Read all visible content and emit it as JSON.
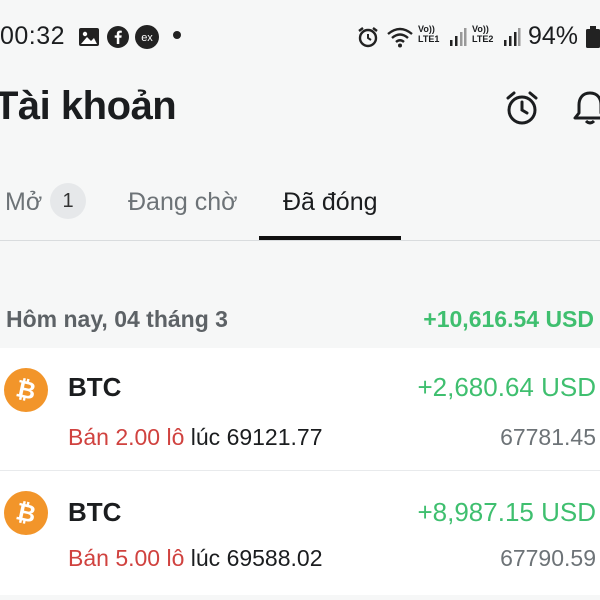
{
  "status_bar": {
    "time": "00:32",
    "icons": [
      "image-icon",
      "facebook-icon",
      "exness-icon",
      "dot-icon",
      "alarm-icon",
      "wifi-icon",
      "signal-sim1-icon",
      "signal-sim2-icon",
      "battery-icon"
    ],
    "sim1_label_top": "Vo))",
    "sim1_label_bottom": "LTE1",
    "sim2_label_top": "Vo))",
    "sim2_label_bottom": "LTE2",
    "exness_label": "ex",
    "battery": "94%"
  },
  "header": {
    "title": "Tài khoản",
    "icons": [
      "alarm-clock-icon",
      "bell-icon"
    ]
  },
  "tabs": [
    {
      "label": "Mở",
      "badge": "1",
      "active": false
    },
    {
      "label": "Đang chờ",
      "active": false
    },
    {
      "label": "Đã đóng",
      "active": true
    }
  ],
  "section": {
    "date": "Hôm nay, 04 tháng 3",
    "total": "+10,616.54 USD"
  },
  "trades": [
    {
      "symbol": "BTC",
      "pnl": "+2,680.64 USD",
      "side": "Bán 2.00 lô",
      "at_label": "lúc",
      "open_price": "69121.77",
      "close_price": "67781.45"
    },
    {
      "symbol": "BTC",
      "pnl": "+8,987.15 USD",
      "side": "Bán 5.00 lô",
      "at_label": "lúc",
      "open_price": "69588.02",
      "close_price": "67790.59"
    }
  ],
  "colors": {
    "positive": "#3fbf6f",
    "sell": "#d0423f",
    "bitcoin": "#f2952a",
    "background": "#f6f7f7"
  }
}
